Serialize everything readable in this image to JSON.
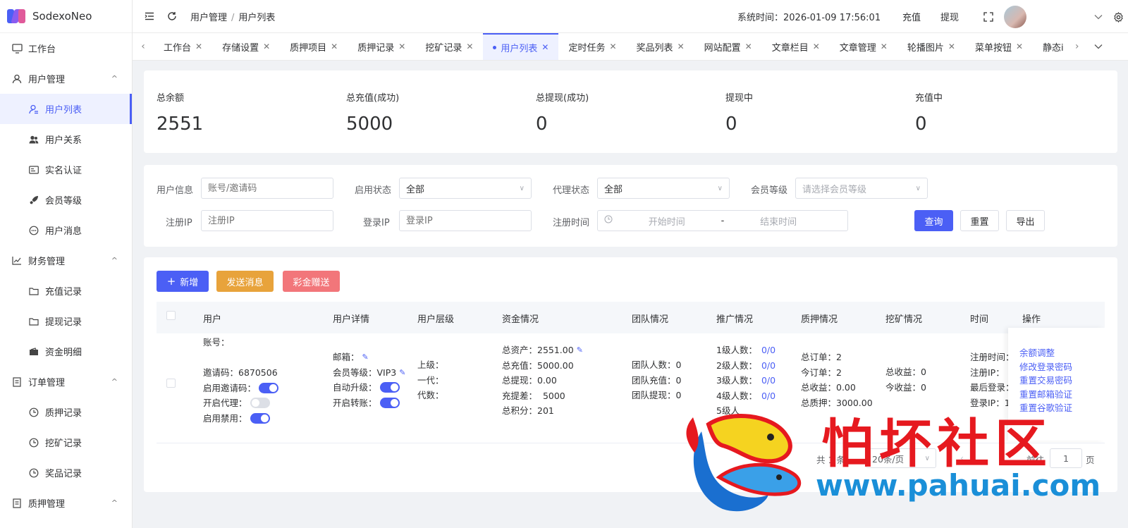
{
  "app": {
    "name": "SodexoNeo"
  },
  "sidebar": {
    "items": [
      {
        "label": "工作台",
        "icon": "monitor-icon",
        "level": 0
      },
      {
        "label": "用户管理",
        "icon": "user-icon",
        "level": 0,
        "expanded": true
      },
      {
        "label": "用户列表",
        "icon": "user-list-icon",
        "level": 1,
        "active": true
      },
      {
        "label": "用户关系",
        "icon": "users-icon",
        "level": 1
      },
      {
        "label": "实名认证",
        "icon": "id-card-icon",
        "level": 1
      },
      {
        "label": "会员等级",
        "icon": "rocket-icon",
        "level": 1
      },
      {
        "label": "用户消息",
        "icon": "chat-icon",
        "level": 1
      },
      {
        "label": "财务管理",
        "icon": "chart-icon",
        "level": 0,
        "expanded": true
      },
      {
        "label": "充值记录",
        "icon": "folder-icon",
        "level": 1
      },
      {
        "label": "提现记录",
        "icon": "folder-icon",
        "level": 1
      },
      {
        "label": "资金明细",
        "icon": "wallet-icon",
        "level": 1
      },
      {
        "label": "订单管理",
        "icon": "document-icon",
        "level": 0,
        "expanded": true
      },
      {
        "label": "质押记录",
        "icon": "clock-icon",
        "level": 1
      },
      {
        "label": "挖矿记录",
        "icon": "clock-icon",
        "level": 1
      },
      {
        "label": "奖品记录",
        "icon": "clock-icon",
        "level": 1
      },
      {
        "label": "质押管理",
        "icon": "document-icon",
        "level": 0,
        "expanded": true
      }
    ]
  },
  "header": {
    "breadcrumb": [
      "用户管理",
      "用户列表"
    ],
    "breadcrumb_sep": "/",
    "system_time_label": "系统时间：",
    "system_time": "2026-01-09 17:56:01",
    "recharge": "充值",
    "withdraw": "提现"
  },
  "tabs": [
    {
      "label": "工作台",
      "active": false
    },
    {
      "label": "存储设置",
      "active": false
    },
    {
      "label": "质押项目",
      "active": false
    },
    {
      "label": "质押记录",
      "active": false
    },
    {
      "label": "挖矿记录",
      "active": false
    },
    {
      "label": "用户列表",
      "active": true
    },
    {
      "label": "定时任务",
      "active": false
    },
    {
      "label": "奖品列表",
      "active": false
    },
    {
      "label": "网站配置",
      "active": false
    },
    {
      "label": "文章栏目",
      "active": false
    },
    {
      "label": "文章管理",
      "active": false
    },
    {
      "label": "轮播图片",
      "active": false
    },
    {
      "label": "菜单按钮",
      "active": false
    },
    {
      "label": "静态i",
      "active": false
    }
  ],
  "stats": [
    {
      "label": "总余额",
      "value": "2551"
    },
    {
      "label": "总充值(成功)",
      "value": "5000"
    },
    {
      "label": "总提现(成功)",
      "value": "0"
    },
    {
      "label": "提现中",
      "value": "0"
    },
    {
      "label": "充值中",
      "value": "0"
    }
  ],
  "filters": {
    "user_info_label": "用户信息",
    "user_info_placeholder": "账号/邀请码",
    "enable_status_label": "启用状态",
    "enable_status_value": "全部",
    "agent_status_label": "代理状态",
    "agent_status_value": "全部",
    "member_level_label": "会员等级",
    "member_level_placeholder": "请选择会员等级",
    "reg_ip_label": "注册IP",
    "reg_ip_placeholder": "注册IP",
    "login_ip_label": "登录IP",
    "login_ip_placeholder": "登录IP",
    "reg_time_label": "注册时间",
    "start_placeholder": "开始时间",
    "range_sep": "-",
    "end_placeholder": "结束时间",
    "query": "查询",
    "reset": "重置",
    "export": "导出"
  },
  "actions": {
    "add": "新增",
    "send_message": "发送消息",
    "bonus_gift": "彩金赠送"
  },
  "table": {
    "columns": [
      "用户",
      "用户详情",
      "用户层级",
      "资金情况",
      "团队情况",
      "推广情况",
      "质押情况",
      "挖矿情况",
      "时间",
      "操作"
    ],
    "row": {
      "user": {
        "account": "账号：",
        "invite_code": "邀请码：6870506",
        "enable_invite": "启用邀请码：",
        "open_agent": "开启代理：",
        "enable_ban": "启用禁用："
      },
      "detail": {
        "email": "邮箱：",
        "member_level": "会员等级：VIP3",
        "auto_upgrade": "自动升级：",
        "open_transfer": "开启转账："
      },
      "level": {
        "superior": "上级：",
        "first_gen": "一代：",
        "generation": "代数："
      },
      "funds": {
        "total_assets": "总资产：2551.00",
        "total_recharge": "总充值：5000.00",
        "total_withdraw": "总提现：0.00",
        "recharge_diff": "充提差：  5000",
        "total_points": "总积分：201"
      },
      "team": {
        "members": "团队人数：0",
        "recharge": "团队充值：0",
        "withdraw": "团队提现：0"
      },
      "promo": [
        {
          "label": "1级人数：",
          "value": "0/0"
        },
        {
          "label": "2级人数：",
          "value": "0/0"
        },
        {
          "label": "3级人数：",
          "value": "0/0"
        },
        {
          "label": "4级人数：",
          "value": "0/0"
        },
        {
          "label": "5级人",
          "value": ""
        }
      ],
      "stake": {
        "total_orders": "总订单：2",
        "today_orders": "今订单：2",
        "total_income": "总收益：0.00",
        "total_stake": "总质押：3000.00"
      },
      "mining": {
        "total_income": "总收益：0",
        "today_income": "今收益：0"
      },
      "time": {
        "reg_time": "注册时间：",
        "reg_ip": "注册IP：",
        "last_login": "最后登录：",
        "login_ip": "登录IP：1"
      },
      "ops": [
        "余额调整",
        "修改登录密码",
        "重置交易密码",
        "重置邮箱验证",
        "重置谷歌验证"
      ]
    }
  },
  "pagination": {
    "total": "共 1 条",
    "page_size": "20条/页",
    "goto": "前往",
    "page": "1",
    "page_suffix": "页"
  },
  "watermark": {
    "title": "怕坏社区",
    "url": "www.pahuai.com"
  },
  "colors": {
    "primary": "#4b5ff5",
    "orange": "#e8a33b",
    "red": "#f2767a",
    "watermark_red": "#e6191f",
    "watermark_blue": "#1a8fd8"
  }
}
